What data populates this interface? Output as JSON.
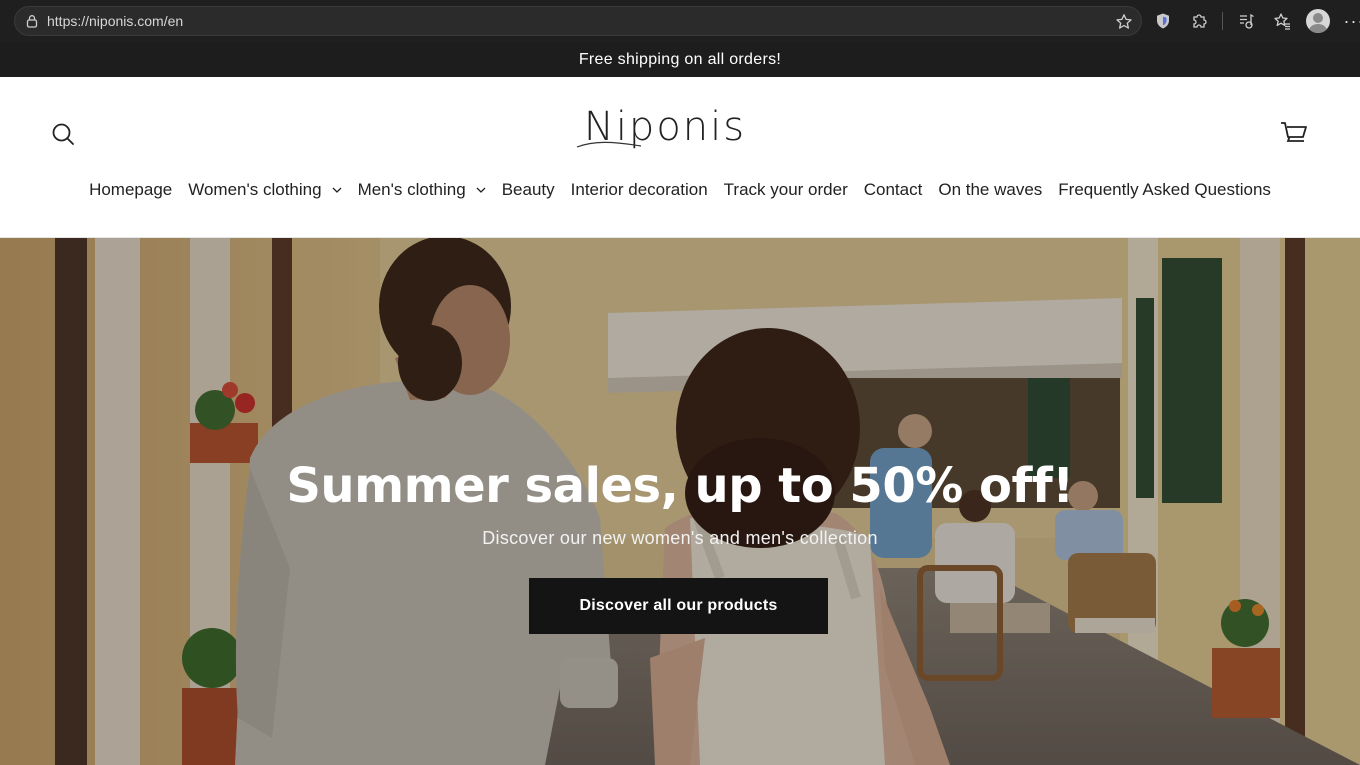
{
  "browser": {
    "url": "https://niponis.com/en",
    "icons": [
      "lock-icon",
      "star-icon",
      "shield-icon",
      "extensions-icon",
      "media-icon",
      "favorites-icon",
      "profile-avatar",
      "more-icon"
    ],
    "more_label": "···"
  },
  "announcement": {
    "text": "Free shipping on all orders!"
  },
  "header": {
    "logo": "Niponis",
    "icons": [
      "search-icon",
      "cart-icon"
    ]
  },
  "nav": {
    "items": [
      {
        "label": "Homepage",
        "dropdown": false
      },
      {
        "label": "Women's clothing",
        "dropdown": true
      },
      {
        "label": "Men's clothing",
        "dropdown": true
      },
      {
        "label": "Beauty",
        "dropdown": false
      },
      {
        "label": "Interior decoration",
        "dropdown": false
      },
      {
        "label": "Track your order",
        "dropdown": false
      },
      {
        "label": "Contact",
        "dropdown": false
      },
      {
        "label": "On the waves",
        "dropdown": false
      },
      {
        "label": "Frequently Asked Questions",
        "dropdown": false
      }
    ]
  },
  "hero": {
    "title": "Summer sales, up to 50% off!",
    "subtitle": "Discover our new women's and men's collection",
    "cta": "Discover all our products"
  },
  "colors": {
    "announcement_bg": "#1d1d1d",
    "cta_bg": "#141414",
    "browser_bg": "#1f1f1f"
  }
}
